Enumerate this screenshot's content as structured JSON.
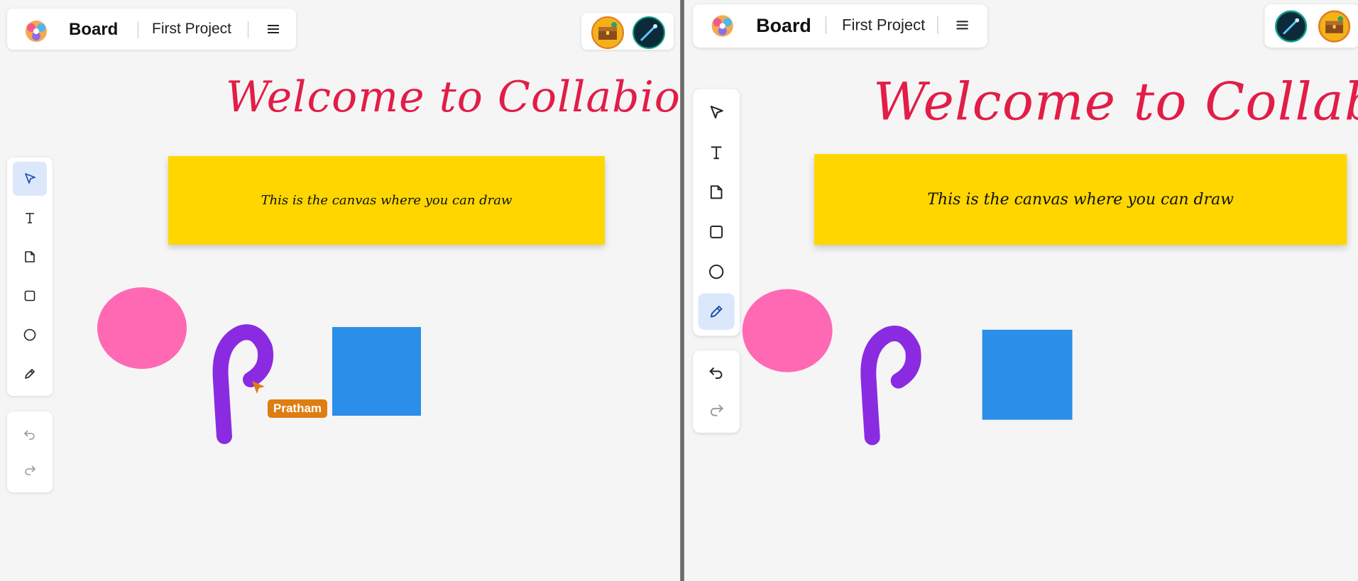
{
  "header": {
    "board_label": "Board",
    "project_name": "First Project"
  },
  "canvas": {
    "welcome_text": "Welcome to Collabio",
    "note_text": "This is the canvas where you can draw",
    "cursor_name": "Pratham"
  },
  "toolbar": {
    "tools": [
      "select",
      "text",
      "note",
      "rectangle",
      "ellipse",
      "pen"
    ],
    "left_active_tool": "select",
    "right_active_tool": "pen"
  },
  "icons": {
    "logo": "collabio-logo-icon",
    "menu": "hamburger-menu-icon",
    "undo": "undo-icon",
    "redo": "redo-icon"
  },
  "colors": {
    "welcome": "#e21d48",
    "note": "#ffd600",
    "ellipse": "#ff69b4",
    "rectangle": "#2b8ee8",
    "stroke": "#8a2be2",
    "cursor": "#df7d12",
    "active_tool_bg": "#dbe8fb"
  }
}
